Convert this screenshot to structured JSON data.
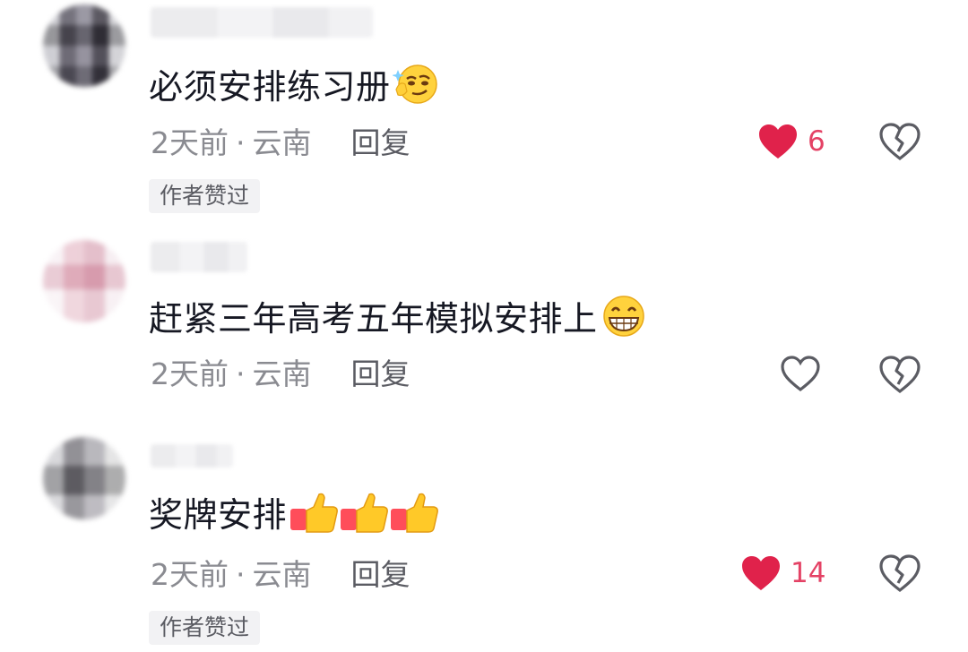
{
  "comments": [
    {
      "text": "必须安排练习册",
      "emoji": "smirk-emoji",
      "time": "2天前",
      "dot": "·",
      "location": "云南",
      "reply_label": "回复",
      "likes": "6",
      "liked": true,
      "badge": "作者赞过"
    },
    {
      "text": "赶紧三年高考五年模拟安排上",
      "emoji": "grin-emoji",
      "time": "2天前",
      "dot": "·",
      "location": "云南",
      "reply_label": "回复",
      "likes": "",
      "liked": false
    },
    {
      "text": "奖牌安排",
      "emoji": "thumbs-up-emoji",
      "time": "2天前",
      "dot": "·",
      "location": "云南",
      "reply_label": "回复",
      "likes": "14",
      "liked": true,
      "badge": "作者赞过"
    }
  ],
  "colors": {
    "like_active": "#e0224b",
    "meta_text": "#8a8b91",
    "badge_bg": "#f2f2f4"
  }
}
